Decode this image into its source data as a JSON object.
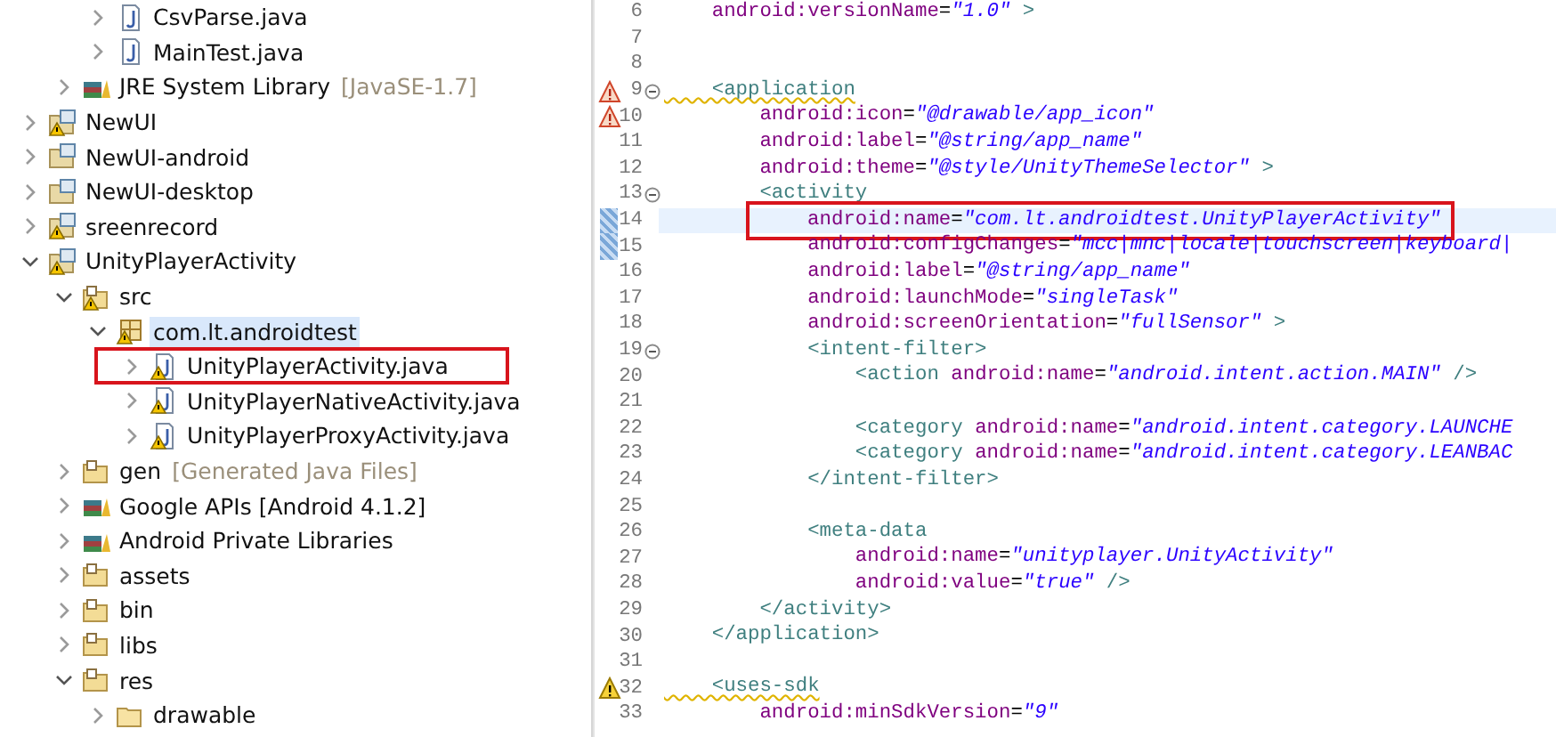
{
  "tree": {
    "items": [
      {
        "children": [
          {
            "children": [
              {
                "label": "CsvParse.java",
                "kind": "java",
                "warning": false,
                "expanded": false,
                "selected": false,
                "highlighted": false
              },
              {
                "label": "MainTest.java",
                "kind": "java",
                "warning": false,
                "expanded": false,
                "selected": false,
                "highlighted": false
              }
            ]
          },
          {
            "label": "JRE System Library",
            "decoration": "[JavaSE-1.7]",
            "kind": "library",
            "warning": false,
            "expanded": false,
            "selected": false,
            "highlighted": false
          }
        ]
      },
      {
        "label": "NewUI",
        "kind": "project",
        "warning": true,
        "expanded": false,
        "selected": false,
        "highlighted": false
      },
      {
        "label": "NewUI-android",
        "kind": "project",
        "warning": false,
        "expanded": false,
        "selected": false,
        "highlighted": false
      },
      {
        "label": "NewUI-desktop",
        "kind": "project",
        "warning": false,
        "expanded": false,
        "selected": false,
        "highlighted": false
      },
      {
        "label": "sreenrecord",
        "kind": "project",
        "warning": true,
        "expanded": false,
        "selected": false,
        "highlighted": false
      },
      {
        "label": "UnityPlayerActivity",
        "kind": "project",
        "warning": true,
        "expanded": true,
        "selected": false,
        "highlighted": false,
        "children": [
          {
            "label": "src",
            "kind": "source-folder",
            "warning": true,
            "expanded": true,
            "selected": false,
            "highlighted": false,
            "children": [
              {
                "label": "com.lt.androidtest",
                "kind": "package",
                "warning": true,
                "expanded": true,
                "selected": true,
                "highlighted": false,
                "children": [
                  {
                    "label": "UnityPlayerActivity.java",
                    "kind": "java",
                    "warning": true,
                    "expanded": false,
                    "selected": false,
                    "highlighted": true
                  },
                  {
                    "label": "UnityPlayerNativeActivity.java",
                    "kind": "java",
                    "warning": true,
                    "expanded": false,
                    "selected": false,
                    "highlighted": false
                  },
                  {
                    "label": "UnityPlayerProxyActivity.java",
                    "kind": "java",
                    "warning": true,
                    "expanded": false,
                    "selected": false,
                    "highlighted": false
                  }
                ]
              }
            ]
          },
          {
            "label": "gen",
            "decoration": "[Generated Java Files]",
            "kind": "source-folder",
            "warning": false,
            "expanded": false,
            "selected": false,
            "highlighted": false
          },
          {
            "label": "Google APIs [Android 4.1.2]",
            "kind": "library",
            "warning": false,
            "expanded": false,
            "selected": false,
            "highlighted": false
          },
          {
            "label": "Android Private Libraries",
            "kind": "library",
            "warning": false,
            "expanded": false,
            "selected": false,
            "highlighted": false
          },
          {
            "label": "assets",
            "kind": "source-folder",
            "warning": false,
            "expanded": false,
            "selected": false,
            "highlighted": false
          },
          {
            "label": "bin",
            "kind": "source-folder",
            "warning": false,
            "expanded": false,
            "selected": false,
            "highlighted": false
          },
          {
            "label": "libs",
            "kind": "source-folder",
            "warning": false,
            "expanded": false,
            "selected": false,
            "highlighted": false
          },
          {
            "label": "res",
            "kind": "source-folder",
            "warning": false,
            "expanded": true,
            "selected": false,
            "highlighted": false,
            "children": [
              {
                "label": "drawable",
                "kind": "folder",
                "warning": false,
                "expanded": false,
                "selected": false,
                "highlighted": false
              }
            ]
          }
        ]
      }
    ]
  },
  "editor": {
    "lines": [
      {
        "number": "6",
        "tokens": [
          {
            "kind": "attr",
            "text": "    android:versionName"
          },
          {
            "kind": "plain",
            "text": "="
          },
          {
            "kind": "value",
            "text": "\"1.0\""
          },
          {
            "kind": "tag",
            "text": " >"
          }
        ]
      },
      {
        "number": "7"
      },
      {
        "number": "8"
      },
      {
        "number": "9",
        "marker": {
          "kind": "problem"
        },
        "fold": true,
        "tokens": [
          {
            "kind": "tag",
            "text": "    <application",
            "squiggle": true
          }
        ]
      },
      {
        "number": "10",
        "marker": {
          "kind": "problem"
        },
        "tokens": [
          {
            "kind": "attr",
            "text": "        android:icon"
          },
          {
            "kind": "plain",
            "text": "="
          },
          {
            "kind": "value",
            "text": "\"@drawable/app_icon\""
          }
        ]
      },
      {
        "number": "11",
        "tokens": [
          {
            "kind": "attr",
            "text": "        android:label"
          },
          {
            "kind": "plain",
            "text": "="
          },
          {
            "kind": "value",
            "text": "\"@string/app_name\""
          }
        ]
      },
      {
        "number": "12",
        "tokens": [
          {
            "kind": "attr",
            "text": "        android:theme"
          },
          {
            "kind": "plain",
            "text": "="
          },
          {
            "kind": "value",
            "text": "\"@style/UnityThemeSelector\""
          },
          {
            "kind": "tag",
            "text": " >"
          }
        ]
      },
      {
        "number": "13",
        "fold": true,
        "tokens": [
          {
            "kind": "tag",
            "text": "        <activity"
          }
        ]
      },
      {
        "number": "14",
        "marker": {
          "kind": "change"
        },
        "current": true,
        "highlighted": true,
        "tokens": [
          {
            "kind": "attr",
            "text": "            android:name"
          },
          {
            "kind": "plain",
            "text": "="
          },
          {
            "kind": "value",
            "text": "\"com.lt.androidtest.UnityPlayerActivity\""
          }
        ]
      },
      {
        "number": "15",
        "marker": {
          "kind": "change"
        },
        "tokens": [
          {
            "kind": "attr",
            "text": "            android:configChanges"
          },
          {
            "kind": "plain",
            "text": "="
          },
          {
            "kind": "value",
            "text": "\"mcc|mnc|locale|touchscreen|keyboard|"
          }
        ]
      },
      {
        "number": "16",
        "tokens": [
          {
            "kind": "attr",
            "text": "            android:label"
          },
          {
            "kind": "plain",
            "text": "="
          },
          {
            "kind": "value",
            "text": "\"@string/app_name\""
          }
        ]
      },
      {
        "number": "17",
        "tokens": [
          {
            "kind": "attr",
            "text": "            android:launchMode"
          },
          {
            "kind": "plain",
            "text": "="
          },
          {
            "kind": "value",
            "text": "\"singleTask\""
          }
        ]
      },
      {
        "number": "18",
        "tokens": [
          {
            "kind": "attr",
            "text": "            android:screenOrientation"
          },
          {
            "kind": "plain",
            "text": "="
          },
          {
            "kind": "value",
            "text": "\"fullSensor\""
          },
          {
            "kind": "tag",
            "text": " >"
          }
        ]
      },
      {
        "number": "19",
        "fold": true,
        "tokens": [
          {
            "kind": "tag",
            "text": "            <intent-filter>"
          }
        ]
      },
      {
        "number": "20",
        "tokens": [
          {
            "kind": "tag",
            "text": "                <action "
          },
          {
            "kind": "attr",
            "text": "android:name"
          },
          {
            "kind": "plain",
            "text": "="
          },
          {
            "kind": "value",
            "text": "\"android.intent.action.MAIN\""
          },
          {
            "kind": "tag",
            "text": " />"
          }
        ]
      },
      {
        "number": "21"
      },
      {
        "number": "22",
        "tokens": [
          {
            "kind": "tag",
            "text": "                <category "
          },
          {
            "kind": "attr",
            "text": "android:name"
          },
          {
            "kind": "plain",
            "text": "="
          },
          {
            "kind": "value",
            "text": "\"android.intent.category.LAUNCHE"
          }
        ]
      },
      {
        "number": "23",
        "tokens": [
          {
            "kind": "tag",
            "text": "                <category "
          },
          {
            "kind": "attr",
            "text": "android:name"
          },
          {
            "kind": "plain",
            "text": "="
          },
          {
            "kind": "value",
            "text": "\"android.intent.category.LEANBAC"
          }
        ]
      },
      {
        "number": "24",
        "tokens": [
          {
            "kind": "tag",
            "text": "            </intent-filter>"
          }
        ]
      },
      {
        "number": "25"
      },
      {
        "number": "26",
        "tokens": [
          {
            "kind": "tag",
            "text": "            <meta-data"
          }
        ]
      },
      {
        "number": "27",
        "tokens": [
          {
            "kind": "attr",
            "text": "                android:name"
          },
          {
            "kind": "plain",
            "text": "="
          },
          {
            "kind": "value",
            "text": "\"unityplayer.UnityActivity\""
          }
        ]
      },
      {
        "number": "28",
        "tokens": [
          {
            "kind": "attr",
            "text": "                android:value"
          },
          {
            "kind": "plain",
            "text": "="
          },
          {
            "kind": "value",
            "text": "\"true\""
          },
          {
            "kind": "tag",
            "text": " />"
          }
        ]
      },
      {
        "number": "29",
        "tokens": [
          {
            "kind": "tag",
            "text": "        </activity>"
          }
        ]
      },
      {
        "number": "30",
        "tokens": [
          {
            "kind": "tag",
            "text": "    </application>"
          }
        ]
      },
      {
        "number": "31"
      },
      {
        "number": "32",
        "marker": {
          "kind": "warning"
        },
        "tokens": [
          {
            "kind": "tag",
            "text": "    <uses-sdk",
            "squiggle": true
          }
        ]
      },
      {
        "number": "33",
        "tokens": [
          {
            "kind": "attr",
            "text": "        android:minSdkVersion"
          },
          {
            "kind": "plain",
            "text": "="
          },
          {
            "kind": "value",
            "text": "\"9\""
          }
        ]
      }
    ]
  }
}
